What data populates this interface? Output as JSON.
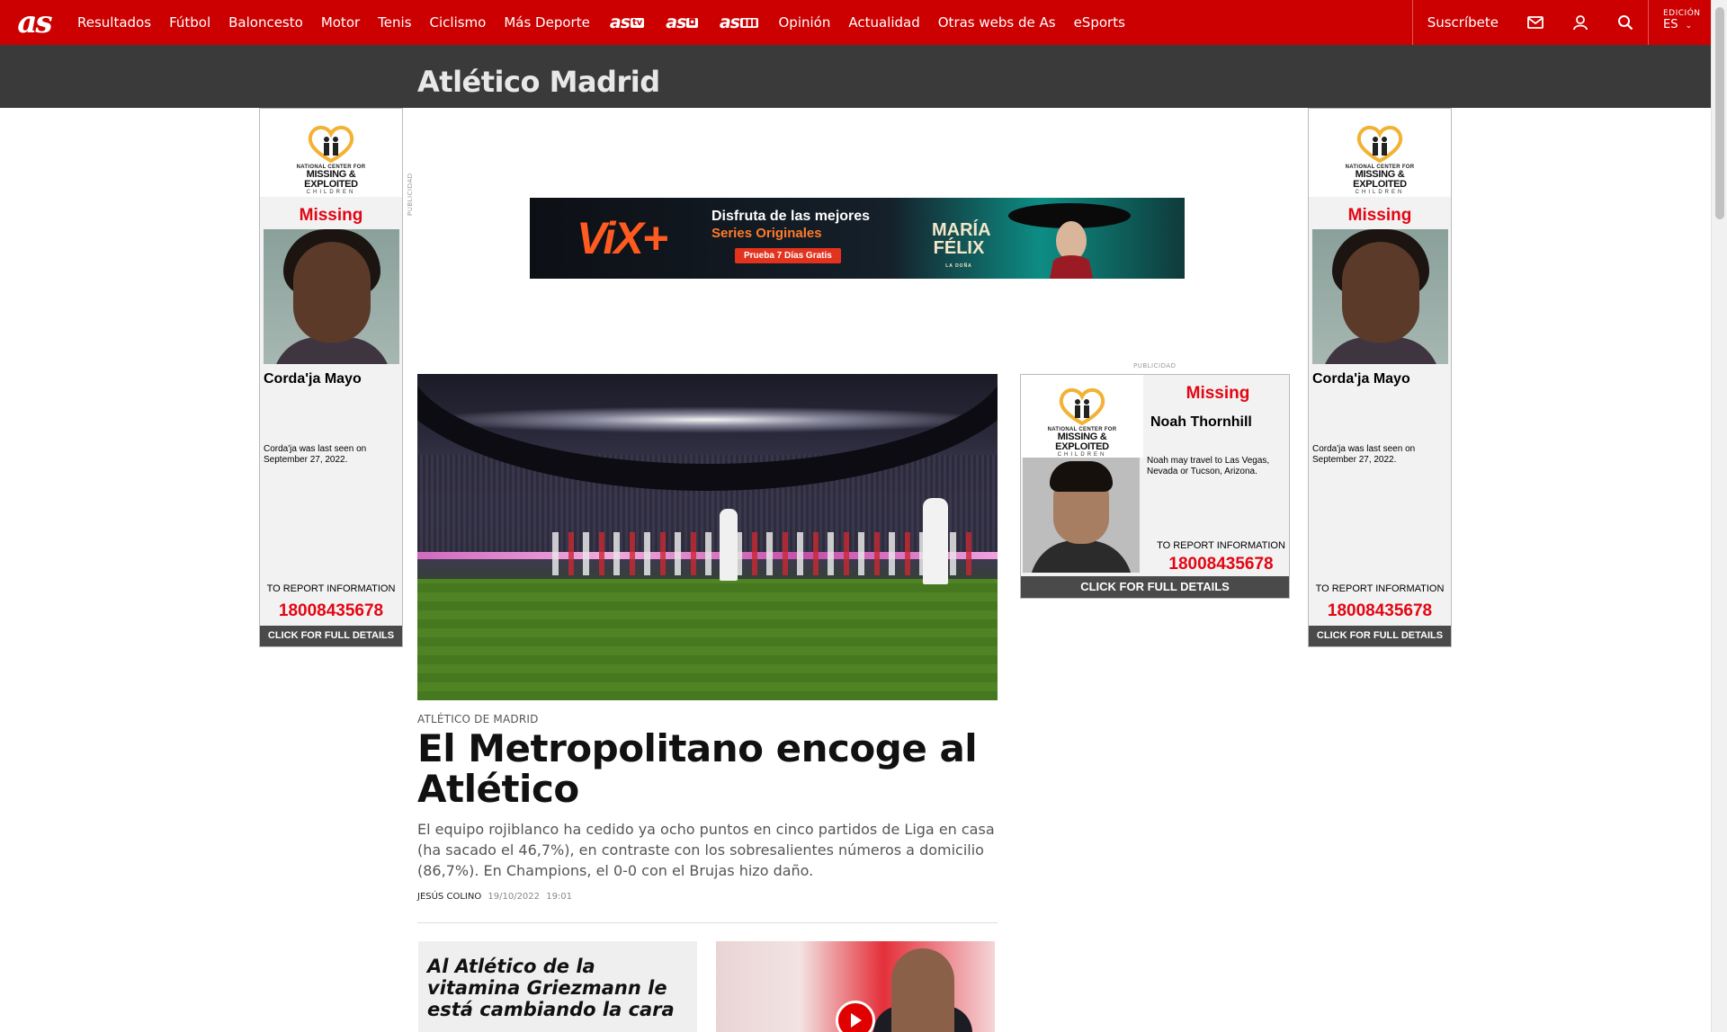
{
  "nav": {
    "logo": "as",
    "links": [
      "Resultados",
      "Fútbol",
      "Baloncesto",
      "Motor",
      "Tenis",
      "Ciclismo",
      "Más Deporte"
    ],
    "brands": [
      {
        "label": "as",
        "badge": "tv"
      },
      {
        "label": "as",
        "badge": "◘"
      },
      {
        "label": "as",
        "badge": "▮▮▮"
      }
    ],
    "links2": [
      "Opinión",
      "Actualidad",
      "Otras webs de As",
      "eSports"
    ],
    "subscribe": "Suscríbete",
    "edition_label": "EDICIÓN",
    "edition_value": "ES"
  },
  "section": {
    "title": "Atlético Madrid"
  },
  "ads": {
    "publicidad": "PUBLICIDAD",
    "banner": {
      "brand": "ViX+",
      "line1": "Disfruta de las mejores",
      "line2": "Series Originales",
      "cta": "Prueba 7 Días Gratis",
      "show": "MARÍA FÉLIX",
      "show_sub": "LA DOÑA"
    },
    "ncmec": {
      "org_top": "NATIONAL CENTER FOR",
      "org_main1": "MISSING &",
      "org_main2": "EXPLOITED",
      "org_bottom": "CHILDREN"
    },
    "sky_left": {
      "missing": "Missing",
      "name": "Corda'ja  Mayo",
      "desc": "Corda'ja was last seen on September 27, 2022.",
      "report": "TO REPORT INFORMATION",
      "phone": "18008435678",
      "cta": "CLICK FOR FULL DETAILS"
    },
    "sky_right": {
      "missing": "Missing",
      "name": "Corda'ja  Mayo",
      "desc": "Corda'ja was last seen on September 27, 2022.",
      "report": "TO REPORT INFORMATION",
      "phone": "18008435678",
      "cta": "CLICK FOR FULL DETAILS"
    },
    "box": {
      "missing": "Missing",
      "name": "Noah  Thornhill",
      "desc": "Noah may travel to Las Vegas, Nevada or Tucson, Arizona.",
      "report": "TO REPORT INFORMATION",
      "phone": "18008435678",
      "cta": "CLICK FOR FULL DETAILS"
    }
  },
  "article": {
    "kicker": "ATLÉTICO DE MADRID",
    "headline": "El Metropolitano encoge al Atlético",
    "summary": "El equipo rojiblanco ha cedido ya ocho puntos en cinco partidos de Liga en casa (ha sacado el 46,7%), en contraste con los sobresalientes números a domicilio (86,7%). En Champions, el 0-0 con el Brujas hizo daño.",
    "author": "JESÚS COLINO",
    "date": "19/10/2022",
    "time": "19:01"
  },
  "cards": [
    {
      "title": "Al Atlético de la vitamina Griezmann le está cambiando la cara"
    }
  ],
  "colors": {
    "brand_red": "#cc0000",
    "section_bar": "#3a3a3a",
    "alert_red": "#e30613"
  }
}
